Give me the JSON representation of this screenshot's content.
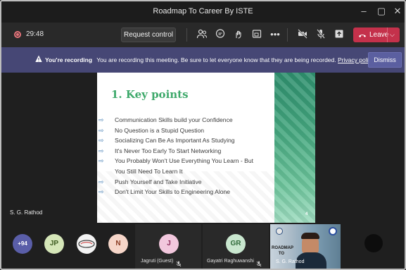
{
  "window": {
    "title": "Roadmap To Career By ISTE",
    "minimize": "–",
    "maximize": "▢",
    "close": "✕"
  },
  "toolbar": {
    "timer": "29:48",
    "request_control": "Request control",
    "more": "•••",
    "leave": "Leave",
    "leave_chevron": "⌵"
  },
  "banner": {
    "bold": "You're recording",
    "message": "You are recording this meeting. Be sure to let everyone know that they are being recorded.",
    "link": "Privacy policy",
    "dismiss": "Dismiss"
  },
  "stage": {
    "speaker": "S. G. Rathod"
  },
  "slide": {
    "heading": "1. Key points",
    "bullets": [
      "Communication Skills build your Confidence",
      "No Question is a Stupid Question",
      "Socializing Can Be As Important As Studying",
      "It's Never Too Early To Start Networking",
      "You Probably Won't Use Everything You Learn - But",
      "You Still Need To Learn It",
      "Push Yourself and Take Initiative",
      "Don't Limit Your Skills to Engineering Alone"
    ],
    "page_number": "4"
  },
  "participants": {
    "overflow": "+94",
    "tiles": [
      {
        "initials": "JP"
      },
      {
        "initials": "N"
      },
      {
        "initials": "J",
        "name": "Jagruti (Guest)"
      },
      {
        "initials": "GR",
        "name": "Gayatri Raghuwanshi"
      },
      {
        "name": "S. G. Rathod",
        "video_text": "ROADMAP TO"
      }
    ]
  },
  "colors": {
    "banner": "#464775",
    "leave": "#c4314b",
    "heading_green": "#3ea96b"
  }
}
